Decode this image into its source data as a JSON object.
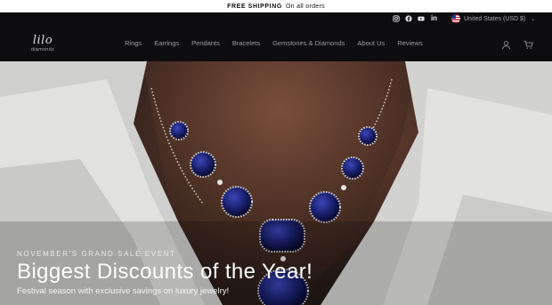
{
  "announcement": {
    "bold": "FREE SHIPPING",
    "text": "On all orders"
  },
  "header": {
    "social": [
      "instagram-icon",
      "facebook-icon",
      "youtube-icon",
      "linkedin-icon"
    ],
    "linkedin_glyph": "in",
    "locale": "United States (USD $)",
    "logo": {
      "script": "lilo",
      "sub": "diamonds"
    },
    "nav": [
      "Rings",
      "Earrings",
      "Pendants",
      "Bracelets",
      "Gemstones & Diamonds",
      "About Us",
      "Reviews"
    ],
    "icons": [
      "user-icon",
      "cart-icon"
    ]
  },
  "hero": {
    "eyebrow": "NOVEMBER'S GRAND SALE EVENT",
    "headline": "Biggest Discounts of the Year!",
    "subline": "Festival season with exclusive savings on luxury jewelry!"
  },
  "colors": {
    "header_bg": "#0d0d0f",
    "announcement_bg": "#ffffff",
    "text_light": "#ffffff",
    "sapphire": "#1b2170"
  }
}
